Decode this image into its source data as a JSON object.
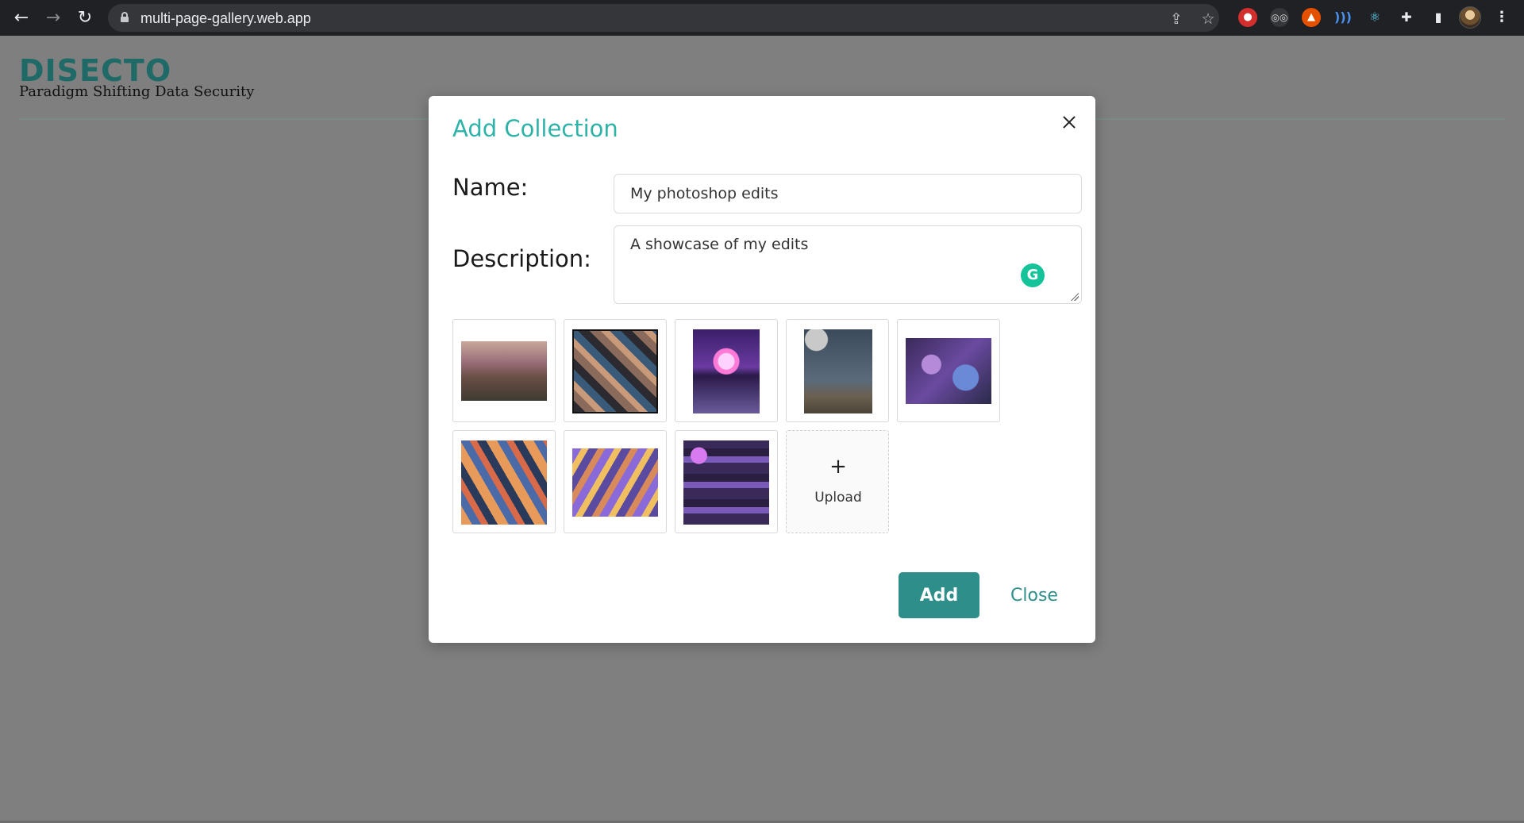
{
  "browser": {
    "url": "multi-page-gallery.web.app",
    "icons": [
      "back-arrow-icon",
      "forward-arrow-icon",
      "reload-icon",
      "lock-icon",
      "share-icon",
      "bookmark-star-icon",
      "extensions-puzzle-icon",
      "side-panel-icon",
      "menu-kebab-icon"
    ]
  },
  "brand": {
    "logo": "DISECTO",
    "tagline": "Paradigm Shifting Data Security",
    "color": "#1f6a67"
  },
  "modal": {
    "title": "Add Collection",
    "name_label": "Name:",
    "name_value": "My photoshop edits",
    "description_label": "Description:",
    "description_value": "A showcase of my edits",
    "upload_plus": "+",
    "upload_label": "Upload",
    "add_button": "Add",
    "close_button": "Close",
    "accent_color": "#2fb2a8",
    "button_color": "#2e8f8a"
  },
  "gallery": {
    "image_count": 8,
    "thumbnails": [
      "sunset-road-trees",
      "photo-collage-dark",
      "synthwave-sun-grid",
      "moon-desert-road",
      "palm-trees-neon-sky",
      "retro-collage-orange",
      "purple-collage-portrait",
      "purple-neon-heart-collage"
    ]
  }
}
